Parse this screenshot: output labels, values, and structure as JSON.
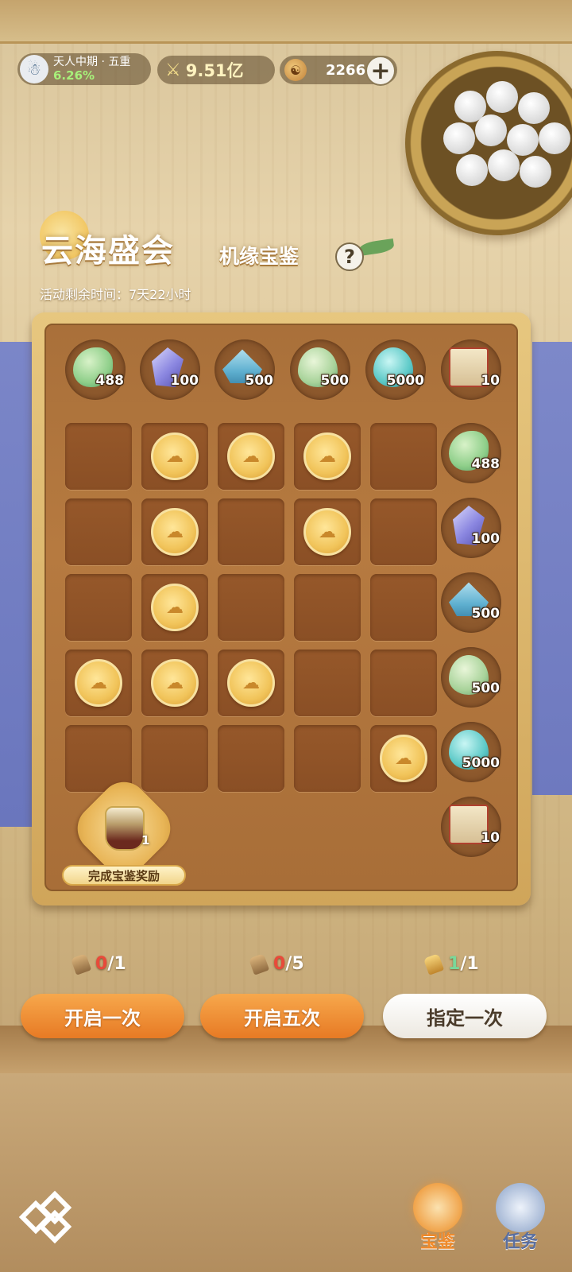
{
  "status": {
    "rank_name": "天人中期 · 五重",
    "rank_progress": "6.26%",
    "power": "9.51亿",
    "currency": "2266"
  },
  "title": {
    "main": "云海盛会",
    "sub": "机缘宝鉴",
    "help": "?",
    "timer": "活动剩余时间：7天22小时"
  },
  "board": {
    "column_rewards": [
      {
        "icon": "jade-hook-icon",
        "qty": "488"
      },
      {
        "icon": "crystal-icon",
        "qty": "100"
      },
      {
        "icon": "blue-box-icon",
        "qty": "500"
      },
      {
        "icon": "jade-drop-icon",
        "qty": "500"
      },
      {
        "icon": "spirit-egg-icon",
        "qty": "5000"
      },
      {
        "icon": "scroll-icon",
        "qty": "10"
      }
    ],
    "row_rewards": [
      {
        "icon": "jade-hook-icon",
        "qty": "488"
      },
      {
        "icon": "crystal-icon",
        "qty": "100"
      },
      {
        "icon": "blue-box-icon",
        "qty": "500"
      },
      {
        "icon": "jade-drop-icon",
        "qty": "500"
      },
      {
        "icon": "spirit-egg-icon",
        "qty": "5000"
      }
    ],
    "final_reward": {
      "icon": "scroll-icon",
      "qty": "10"
    },
    "grid": [
      [
        0,
        1,
        1,
        1,
        0
      ],
      [
        0,
        1,
        0,
        1,
        0
      ],
      [
        0,
        1,
        0,
        0,
        0
      ],
      [
        1,
        1,
        1,
        0,
        0
      ],
      [
        0,
        0,
        0,
        0,
        1
      ]
    ],
    "complete_reward": {
      "label": "完成宝鉴奖励",
      "qty": "1",
      "icon": "mask-armor-icon"
    }
  },
  "actions": {
    "open_once": {
      "label": "开启一次",
      "current": "0",
      "total": "/1"
    },
    "open_five": {
      "label": "开启五次",
      "current": "0",
      "total": "/5"
    },
    "designate_once": {
      "label": "指定一次",
      "current": "1",
      "total": "/1"
    }
  },
  "nav": {
    "treasure": "宝鉴",
    "tasks": "任务"
  },
  "colors": {
    "accent_orange": "#e77a24",
    "medal_gold": "#f1c45a",
    "progress_green": "#a7f07a"
  }
}
